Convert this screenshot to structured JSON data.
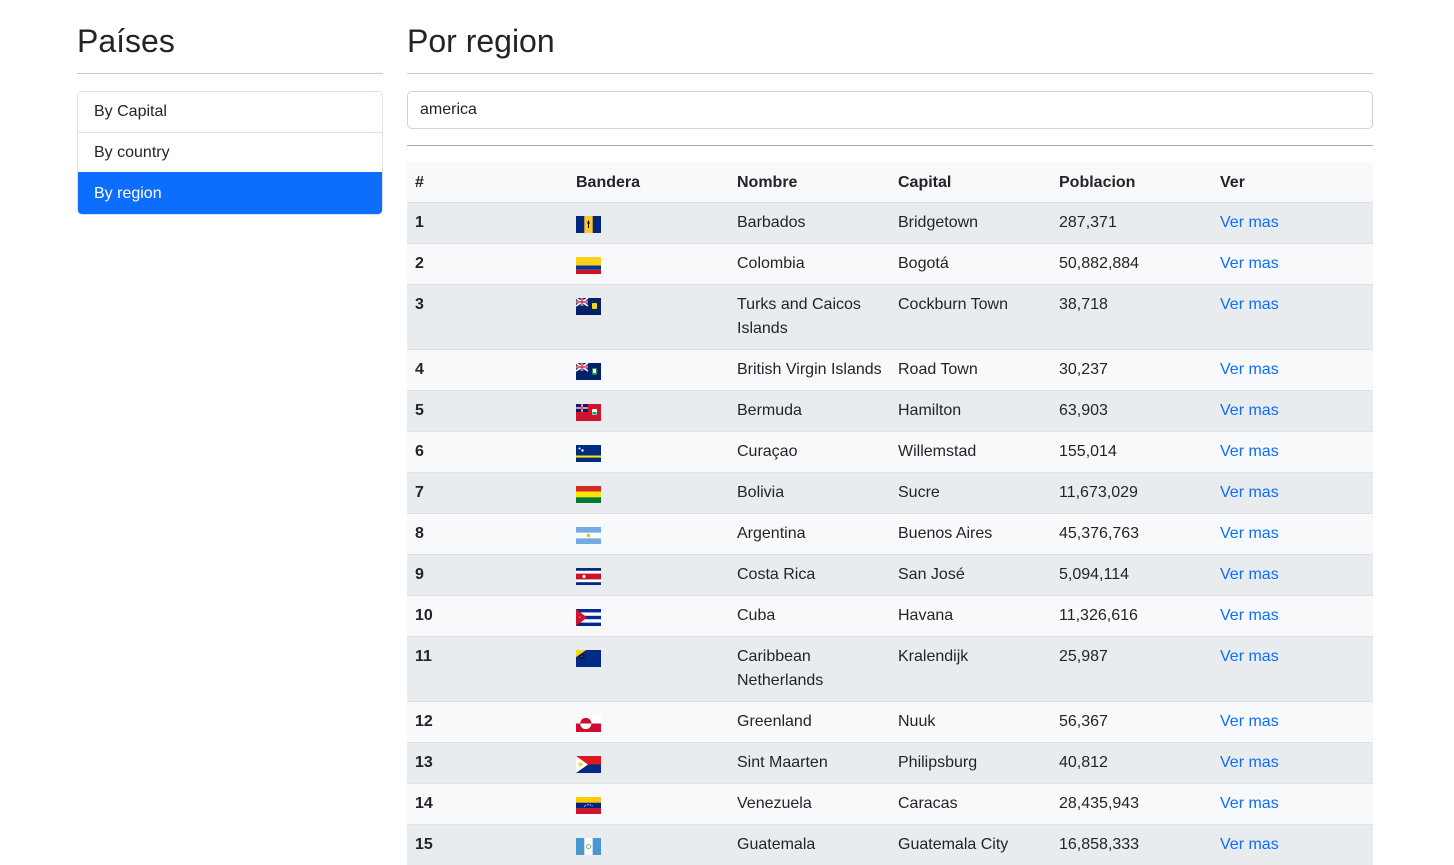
{
  "sidebar": {
    "title": "Países",
    "items": [
      {
        "label": "By Capital",
        "active": false
      },
      {
        "label": "By country",
        "active": false
      },
      {
        "label": "By region",
        "active": true
      }
    ]
  },
  "main": {
    "title": "Por region",
    "search": {
      "value": "america"
    },
    "table": {
      "headers": [
        "#",
        "Bandera",
        "Nombre",
        "Capital",
        "Poblacion",
        "Ver"
      ],
      "link_label": "Ver mas",
      "link_color": "#0d6efd",
      "rows": [
        {
          "num": "1",
          "flag": "barbados-flag-icon",
          "name": "Barbados",
          "capital": "Bridgetown",
          "population": "287,371",
          "link": "Ver mas"
        },
        {
          "num": "2",
          "flag": "colombia-flag-icon",
          "name": "Colombia",
          "capital": "Bogotá",
          "population": "50,882,884",
          "link": "Ver mas"
        },
        {
          "num": "3",
          "flag": "turks-caicos-flag-icon",
          "name": "Turks and Caicos Islands",
          "capital": "Cockburn Town",
          "population": "38,718",
          "link": "Ver mas"
        },
        {
          "num": "4",
          "flag": "british-virgin-islands-flag-icon",
          "name": "British Virgin Islands",
          "capital": "Road Town",
          "population": "30,237",
          "link": "Ver mas"
        },
        {
          "num": "5",
          "flag": "bermuda-flag-icon",
          "name": "Bermuda",
          "capital": "Hamilton",
          "population": "63,903",
          "link": "Ver mas"
        },
        {
          "num": "6",
          "flag": "curacao-flag-icon",
          "name": "Curaçao",
          "capital": "Willemstad",
          "population": "155,014",
          "link": "Ver mas"
        },
        {
          "num": "7",
          "flag": "bolivia-flag-icon",
          "name": "Bolivia",
          "capital": "Sucre",
          "population": "11,673,029",
          "link": "Ver mas"
        },
        {
          "num": "8",
          "flag": "argentina-flag-icon",
          "name": "Argentina",
          "capital": "Buenos Aires",
          "population": "45,376,763",
          "link": "Ver mas"
        },
        {
          "num": "9",
          "flag": "costa-rica-flag-icon",
          "name": "Costa Rica",
          "capital": "San José",
          "population": "5,094,114",
          "link": "Ver mas"
        },
        {
          "num": "10",
          "flag": "cuba-flag-icon",
          "name": "Cuba",
          "capital": "Havana",
          "population": "11,326,616",
          "link": "Ver mas"
        },
        {
          "num": "11",
          "flag": "caribbean-netherlands-flag-icon",
          "name": "Caribbean Netherlands",
          "capital": "Kralendijk",
          "population": "25,987",
          "link": "Ver mas"
        },
        {
          "num": "12",
          "flag": "greenland-flag-icon",
          "name": "Greenland",
          "capital": "Nuuk",
          "population": "56,367",
          "link": "Ver mas"
        },
        {
          "num": "13",
          "flag": "sint-maarten-flag-icon",
          "name": "Sint Maarten",
          "capital": "Philipsburg",
          "population": "40,812",
          "link": "Ver mas"
        },
        {
          "num": "14",
          "flag": "venezuela-flag-icon",
          "name": "Venezuela",
          "capital": "Caracas",
          "population": "28,435,943",
          "link": "Ver mas"
        },
        {
          "num": "15",
          "flag": "guatemala-flag-icon",
          "name": "Guatemala",
          "capital": "Guatemala City",
          "population": "16,858,333",
          "link": "Ver mas"
        }
      ]
    }
  }
}
